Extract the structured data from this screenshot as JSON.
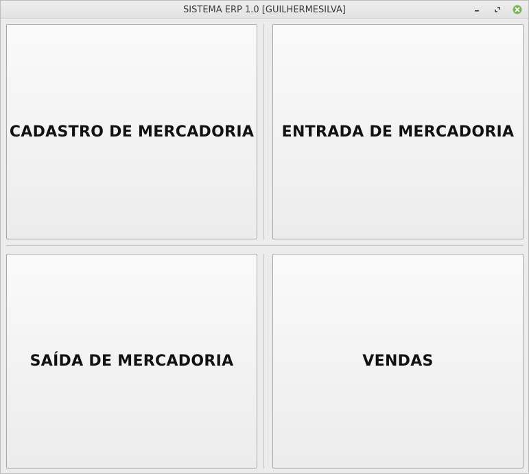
{
  "window": {
    "title": "SISTEMA ERP 1.0 [GUILHERMESILVA]",
    "controls": {
      "minimize_icon": "minimize-icon",
      "maximize_icon": "maximize-icon",
      "close_icon": "close-icon",
      "close_color": "#7ab55c"
    }
  },
  "menu": {
    "buttons": [
      {
        "label": "CADASTRO DE MERCADORIA"
      },
      {
        "label": "ENTRADA DE MERCADORIA"
      },
      {
        "label": "SAÍDA DE MERCADORIA"
      },
      {
        "label": "VENDAS"
      }
    ]
  }
}
